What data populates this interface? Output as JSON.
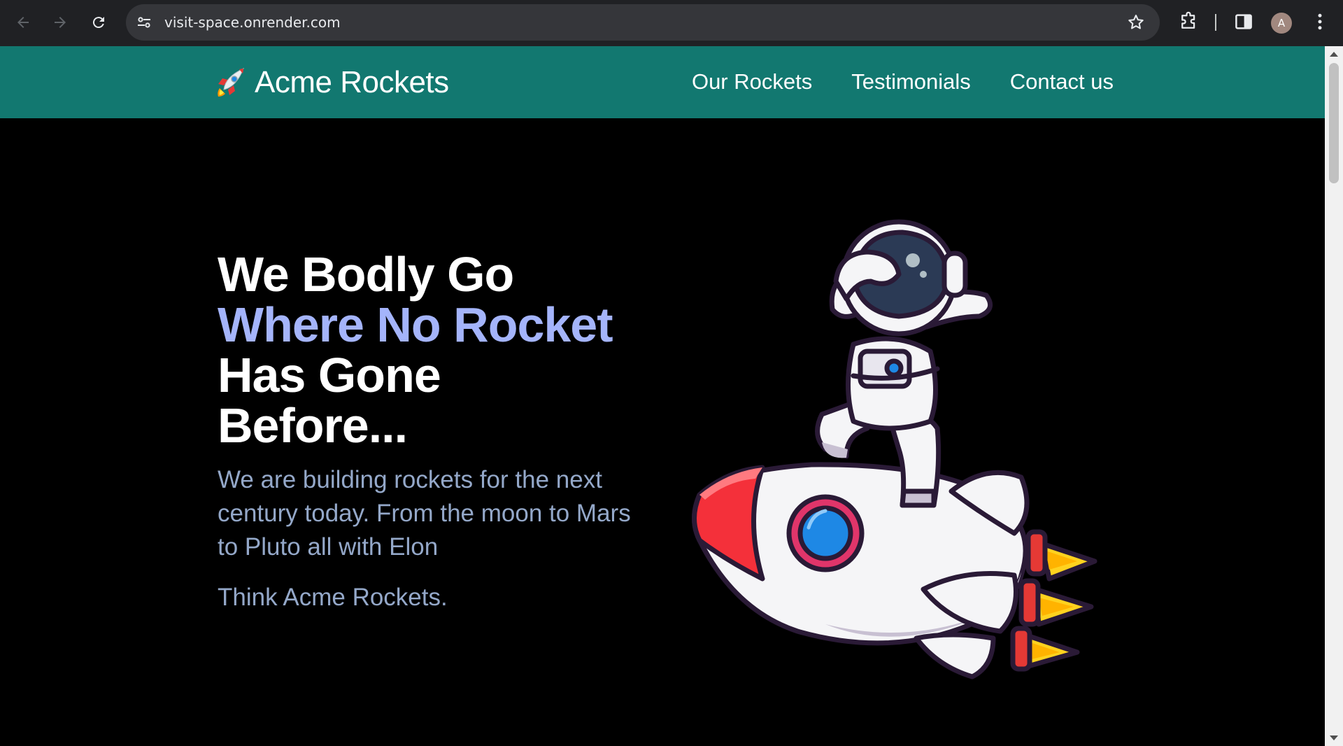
{
  "browser": {
    "url": "visit-space.onrender.com",
    "profile_initial": "A",
    "icons": [
      "back-arrow-icon",
      "forward-arrow-icon",
      "reload-icon",
      "site-settings-icon",
      "bookmark-star-icon",
      "extensions-icon",
      "side-panel-icon",
      "kebab-menu-icon"
    ]
  },
  "site": {
    "brand": "Acme Rockets",
    "nav": {
      "rockets": "Our Rockets",
      "testimonials": "Testimonials",
      "contact": "Contact us"
    }
  },
  "hero": {
    "line1": "We Bodly Go",
    "line2": "Where No Rocket",
    "line3": "Has Gone",
    "line4": "Before...",
    "lead": "We are building rockets for the next century today. From the moon to Mars to Pluto all with Elon",
    "tagline": "Think Acme Rockets."
  },
  "colors": {
    "header_bg": "#127870",
    "page_bg": "#000000",
    "accent": "#a4b4fb",
    "body_text": "#94a8c9",
    "chrome_bg": "#202124"
  }
}
